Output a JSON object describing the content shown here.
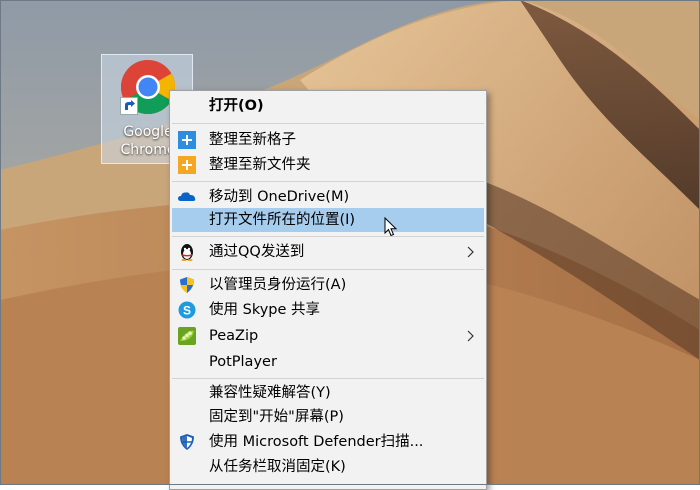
{
  "desktop": {
    "icon_label": "Google Chrome",
    "icon_name": "chrome-icon"
  },
  "menu": {
    "items": [
      {
        "label": "打开(O)",
        "icon": null
      },
      {
        "label": "整理至新格子",
        "icon": "plus-blue-icon"
      },
      {
        "label": "整理至新文件夹",
        "icon": "plus-orange-icon"
      },
      {
        "label": "移动到 OneDrive(M)",
        "icon": "onedrive-cloud-icon"
      },
      {
        "label": "打开文件所在的位置(I)",
        "icon": null
      },
      {
        "label": "通过QQ发送到",
        "icon": "qq-penguin-icon"
      },
      {
        "label": "以管理员身份运行(A)",
        "icon": "uac-shield-icon"
      },
      {
        "label": "使用 Skype 共享",
        "icon": "skype-icon"
      },
      {
        "label": "PeaZip",
        "icon": "peazip-icon"
      },
      {
        "label": "PotPlayer",
        "icon": null
      },
      {
        "label": "兼容性疑难解答(Y)",
        "icon": null
      },
      {
        "label": "固定到\"开始\"屏幕(P)",
        "icon": null
      },
      {
        "label": "使用 Microsoft Defender扫描...",
        "icon": "defender-shield-icon"
      },
      {
        "label": "从任务栏取消固定(K)",
        "icon": null
      }
    ],
    "highlighted_index": 4,
    "highlight_color": "#a7cdee"
  }
}
